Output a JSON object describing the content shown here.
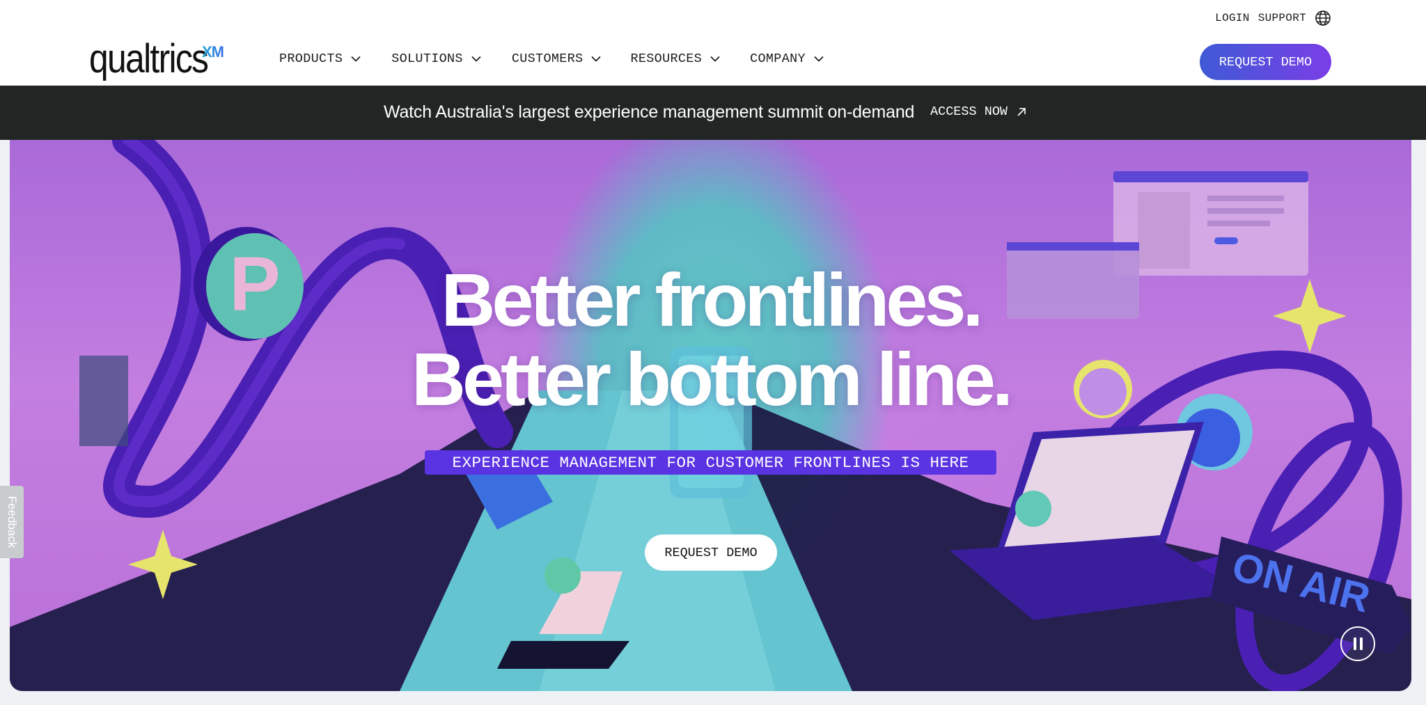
{
  "utility": {
    "login": "LOGIN",
    "support": "SUPPORT",
    "language_icon": "globe-icon"
  },
  "logo": {
    "word": "qualtrics",
    "suffix": "XM"
  },
  "nav": {
    "items": [
      {
        "label": "PRODUCTS",
        "icon": "chevron-down-icon"
      },
      {
        "label": "SOLUTIONS",
        "icon": "chevron-down-icon"
      },
      {
        "label": "CUSTOMERS",
        "icon": "chevron-down-icon"
      },
      {
        "label": "RESOURCES",
        "icon": "chevron-down-icon"
      },
      {
        "label": "COMPANY",
        "icon": "chevron-down-icon"
      }
    ],
    "cta": "REQUEST DEMO"
  },
  "banner": {
    "text": "Watch Australia's largest experience management summit on-demand",
    "link": "ACCESS NOW",
    "link_icon": "external-arrow-icon"
  },
  "hero": {
    "headline_1": "Better frontlines.",
    "headline_2": "Better bottom line.",
    "tagline": "EXPERIENCE MANAGEMENT FOR CUSTOMER FRONTLINES IS HERE",
    "cta": "REQUEST DEMO",
    "pause_icon": "pause-icon",
    "art_sign_text": "ON AIR"
  },
  "feedback": {
    "label": "Feedback"
  },
  "colors": {
    "accent_gradient_start": "#3f5bd6",
    "accent_gradient_end": "#7a3ee6",
    "banner_bg": "#212624",
    "tagline_bg": "#5a33e3"
  }
}
